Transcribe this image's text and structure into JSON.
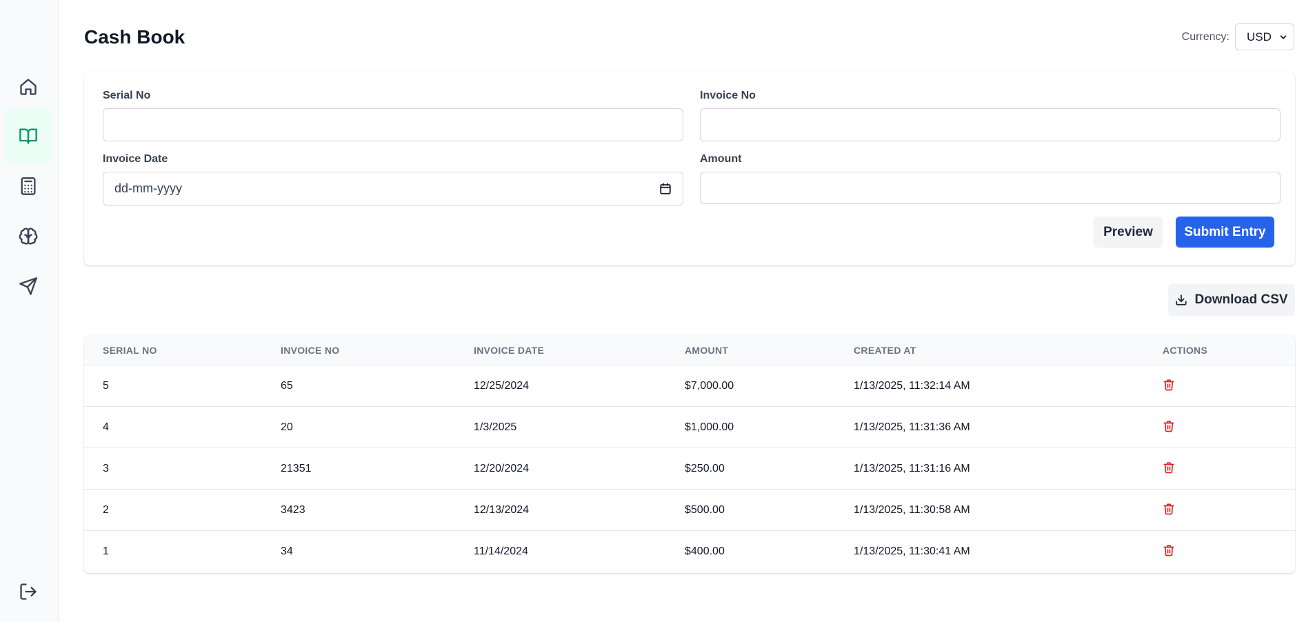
{
  "sidebar": {
    "items": [
      {
        "icon": "home-icon",
        "active": false
      },
      {
        "icon": "book-open-icon",
        "active": true
      },
      {
        "icon": "calculator-icon",
        "active": false
      },
      {
        "icon": "brain-icon",
        "active": false
      },
      {
        "icon": "send-icon",
        "active": false
      }
    ],
    "logout_icon": "logout-icon"
  },
  "header": {
    "title": "Cash Book",
    "currency_label": "Currency:",
    "currency_value": "USD"
  },
  "form": {
    "serial_label": "Serial No",
    "serial_value": "",
    "invoice_no_label": "Invoice No",
    "invoice_no_value": "",
    "invoice_date_label": "Invoice Date",
    "invoice_date_placeholder": "dd-mm-yyyy",
    "amount_label": "Amount",
    "amount_value": "",
    "preview_label": "Preview",
    "submit_label": "Submit Entry"
  },
  "download_label": "Download CSV",
  "table": {
    "columns": [
      "SERIAL NO",
      "INVOICE NO",
      "INVOICE DATE",
      "AMOUNT",
      "CREATED AT",
      "ACTIONS"
    ],
    "rows": [
      [
        "5",
        "65",
        "12/25/2024",
        "$7,000.00",
        "1/13/2025, 11:32:14 AM"
      ],
      [
        "4",
        "20",
        "1/3/2025",
        "$1,000.00",
        "1/13/2025, 11:31:36 AM"
      ],
      [
        "3",
        "21351",
        "12/20/2024",
        "$250.00",
        "1/13/2025, 11:31:16 AM"
      ],
      [
        "2",
        "3423",
        "12/13/2024",
        "$500.00",
        "1/13/2025, 11:30:58 AM"
      ],
      [
        "1",
        "34",
        "11/14/2024",
        "$400.00",
        "1/13/2025, 11:30:41 AM"
      ]
    ]
  },
  "colors": {
    "primary": "#2563eb",
    "active_nav": "#059669",
    "danger": "#dc2626"
  }
}
